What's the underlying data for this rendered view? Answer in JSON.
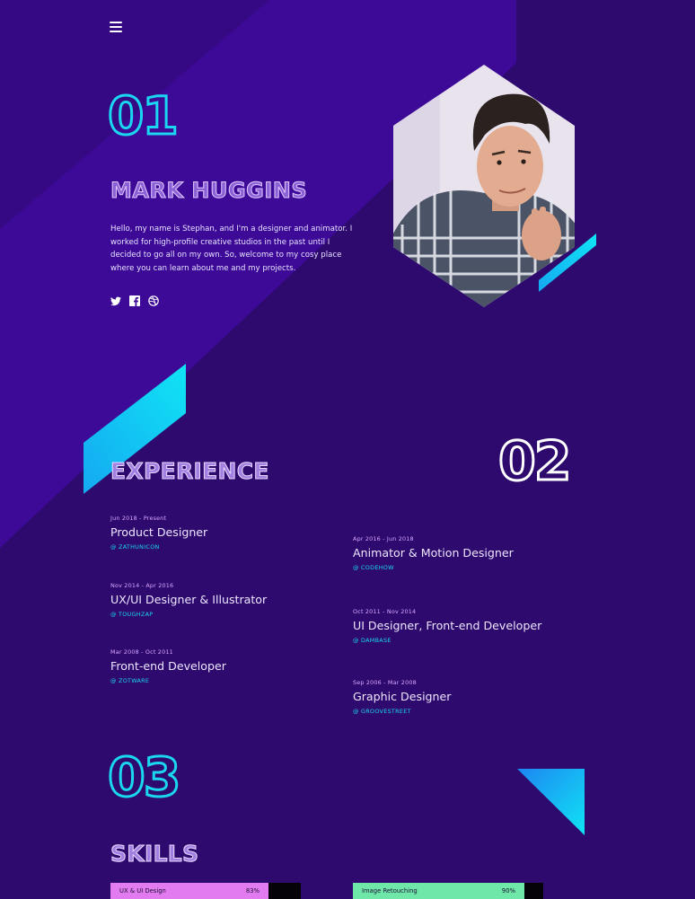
{
  "header": {
    "menu_icon": "hamburger-icon"
  },
  "intro": {
    "number": "01",
    "name": "MARK HUGGINS",
    "bio": "Hello, my name is Stephan, and I'm a designer and animator. I worked for high-profile creative studios in the past until I decided to go all on my own. So, welcome to my cosy place where you can learn about me and my projects.",
    "social": [
      "twitter-icon",
      "facebook-icon",
      "dribbble-icon"
    ]
  },
  "experience": {
    "number": "02",
    "title": "EXPERIENCE",
    "jobs_left": [
      {
        "date": "Jun 2018 -  Present",
        "role": "Product Designer",
        "company": "@ ZATHUNICON"
      },
      {
        "date": "Nov 2014 -  Apr 2016",
        "role": "UX/UI Designer & Illustrator",
        "company": "@ TOUGHZAP"
      },
      {
        "date": "Mar 2008 -  Oct 2011",
        "role": "Front-end Developer",
        "company": "@ ZOTWARE"
      }
    ],
    "jobs_right": [
      {
        "date": "Apr 2016 -  Jun 2018",
        "role": "Animator & Motion Designer",
        "company": "@ CODEHOW"
      },
      {
        "date": "Oct 2011 - Nov 2014",
        "role": "UI Designer, Front-end Developer",
        "company": "@ DAMBASE"
      },
      {
        "date": "Sep 2006 - Mar 2008",
        "role": "Graphic Designer",
        "company": "@ GROOVESTREET"
      }
    ]
  },
  "skills": {
    "number": "03",
    "title": "SKILLS",
    "items": [
      {
        "label": "UX & UI Design",
        "value": "83%",
        "percent": 83,
        "color": "#e27bf0"
      },
      {
        "label": "Image Retouching",
        "value": "90%",
        "percent": 90,
        "color": "#6fe7a8"
      }
    ]
  },
  "colors": {
    "accent": "#1ad6f0",
    "background": "#2e0a6e",
    "panel": "#3f0a9c"
  }
}
